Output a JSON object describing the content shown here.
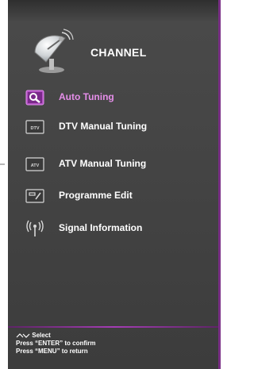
{
  "header": {
    "title": "CHANNEL",
    "icon": "satellite-dish-icon"
  },
  "menu": {
    "items": [
      {
        "label": "Auto Tuning",
        "icon": "search-icon",
        "selected": true
      },
      {
        "label": "DTV Manual Tuning",
        "icon": "dtv-icon",
        "icon_text": "DTV",
        "selected": false
      },
      {
        "label": "ATV Manual Tuning",
        "icon": "atv-icon",
        "icon_text": "ATV",
        "selected": false
      },
      {
        "label": "Programme Edit",
        "icon": "edit-icon",
        "selected": false
      },
      {
        "label": "Signal Information",
        "icon": "signal-icon",
        "selected": false
      }
    ]
  },
  "footer": {
    "select": "Select",
    "confirm": "Press “ENTER” to confirm",
    "return": "Press “MENU” to return"
  },
  "colors": {
    "panel": "#444444",
    "accent": "#c43dd8",
    "selected_text": "#e58ee9",
    "border": "#7a2f86"
  }
}
